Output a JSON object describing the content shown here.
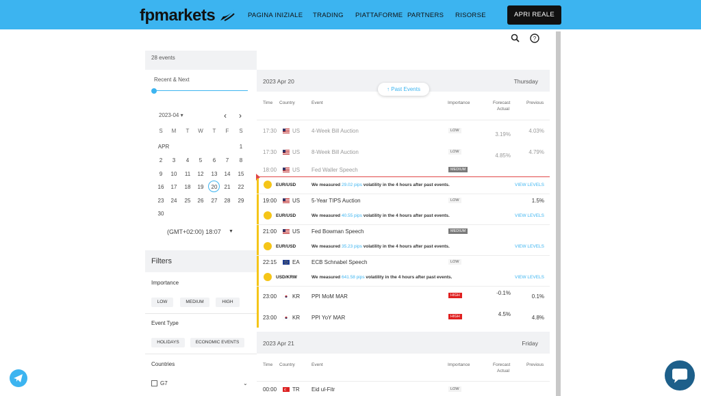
{
  "header": {
    "logo": "fpmarkets",
    "nav": [
      "PAGINA INIZIALE",
      "TRADING",
      "PIATTAFORME",
      "PARTNERS",
      "RISORSE"
    ],
    "cta": "APRI REALE",
    "icons": [
      "search-icon",
      "help-icon"
    ]
  },
  "sidebar": {
    "event_count": "28 events",
    "range_label": "Recent & Next",
    "calendar": {
      "month_label": "2023-04",
      "weekdays": [
        "S",
        "M",
        "T",
        "W",
        "T",
        "F",
        "S"
      ],
      "month_abbr": "APR",
      "selected_day": "20",
      "weeks": [
        [
          "",
          "",
          "",
          "",
          "",
          "",
          "1"
        ],
        [
          "2",
          "3",
          "4",
          "5",
          "6",
          "7",
          "8"
        ],
        [
          "9",
          "10",
          "11",
          "12",
          "13",
          "14",
          "15"
        ],
        [
          "16",
          "17",
          "18",
          "19",
          "20",
          "21",
          "22"
        ],
        [
          "23",
          "24",
          "25",
          "26",
          "27",
          "28",
          "29"
        ],
        [
          "30",
          "",
          "",
          "",
          "",
          "",
          ""
        ]
      ]
    },
    "timezone": "(GMT+02:00) 18:07",
    "filters_title": "Filters",
    "importance_label": "Importance",
    "importance_options": [
      "LOW",
      "MEDIUM",
      "HIGH"
    ],
    "event_type_label": "Event Type",
    "event_type_options": [
      "HOLIDAYS",
      "ECONOMIC EVENTS"
    ],
    "countries_label": "Countries",
    "country_group": "G7"
  },
  "main": {
    "past_events_button": "Past Events",
    "columns": {
      "time": "Time",
      "country": "Country",
      "event": "Event",
      "importance": "Importance",
      "forecast": "Forecast",
      "actual": "Actual",
      "previous": "Previous"
    },
    "day1": {
      "date": "2023 Apr 20",
      "weekday": "Thursday"
    },
    "day2": {
      "date": "2023 Apr 21",
      "weekday": "Friday"
    },
    "events": [
      {
        "time": "17:30",
        "country": "US",
        "event": "4-Week Bill Auction",
        "importance": "LOW",
        "actual": "3.19%",
        "previous": "4.03%"
      },
      {
        "time": "17:30",
        "country": "US",
        "event": "8-Week Bill Auction",
        "importance": "LOW",
        "actual": "4.85%",
        "previous": "4.79%"
      },
      {
        "time": "18:00",
        "country": "US",
        "event": "Fed Waller Speech",
        "importance": "MEDIUM"
      },
      {
        "time": "19:00",
        "country": "US",
        "event": "5-Year TIPS Auction",
        "importance": "LOW",
        "previous": "1.5%"
      },
      {
        "time": "21:00",
        "country": "US",
        "event": "Fed Bowman Speech",
        "importance": "MEDIUM"
      },
      {
        "time": "22:15",
        "country": "EA",
        "event": "ECB Schnabel Speech",
        "importance": "LOW"
      },
      {
        "time": "23:00",
        "country": "KR",
        "event": "PPI MoM MAR",
        "importance": "HIGH",
        "forecast": "-0.1%",
        "previous": "0.1%"
      },
      {
        "time": "23:00",
        "country": "KR",
        "event": "PPI YoY MAR",
        "importance": "HIGH",
        "forecast": "4.5%",
        "previous": "4.8%"
      },
      {
        "time": "00:00",
        "country": "TR",
        "event": "Eid ul-Fitr",
        "importance": "LOW"
      }
    ],
    "volatility": [
      {
        "pair": "EUR/USD",
        "pre": "We measured ",
        "pips": "29.02 pips",
        "post": " volatility in the 4 hours after past events.",
        "link": "VIEW LEVELS"
      },
      {
        "pair": "EUR/USD",
        "pre": "We measured ",
        "pips": "40.55 pips",
        "post": " volatility in the 4 hours after past events.",
        "link": "VIEW LEVELS"
      },
      {
        "pair": "EUR/USD",
        "pre": "We measured ",
        "pips": "35.23 pips",
        "post": " volatility in the 4 hours after past events.",
        "link": "VIEW LEVELS"
      },
      {
        "pair": "USD/KRW",
        "pre": "We measured ",
        "pips": "641.58 pips",
        "post": " volatility in the 4 hours after past events.",
        "link": "VIEW LEVELS"
      }
    ]
  },
  "colors": {
    "accent": "#3cb4f0",
    "high": "#e02020",
    "medium": "#7a7a7a",
    "volatility": "#f5c518"
  }
}
